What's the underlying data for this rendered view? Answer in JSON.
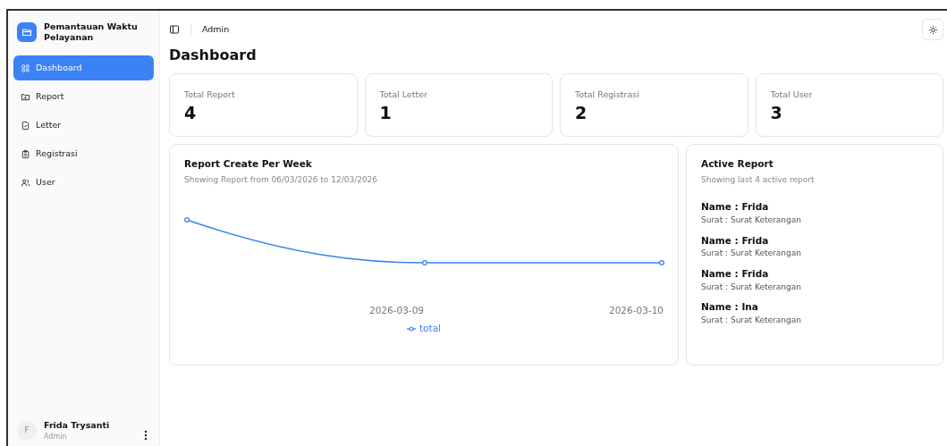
{
  "app": {
    "title": "Pemantauan Waktu Pelayanan"
  },
  "sidebar": {
    "items": [
      {
        "label": "Dashboard",
        "selected": true
      },
      {
        "label": "Report",
        "selected": false
      },
      {
        "label": "Letter",
        "selected": false
      },
      {
        "label": "Registrasi",
        "selected": false
      },
      {
        "label": "User",
        "selected": false
      }
    ]
  },
  "user": {
    "initial": "F",
    "name": "Frida Trysanti",
    "role": "Admin"
  },
  "header": {
    "breadcrumb": "Admin"
  },
  "page_title": "Dashboard",
  "stats": [
    {
      "label": "Total Report",
      "value": "4"
    },
    {
      "label": "Total Letter",
      "value": "1"
    },
    {
      "label": "Total Registrasi",
      "value": "2"
    },
    {
      "label": "Total User",
      "value": "3"
    }
  ],
  "chart_card": {
    "title": "Report Create Per Week",
    "subtitle": "Showing Report from 06/03/2026 to 12/03/2026",
    "x_labels": [
      "2026-03-09",
      "2026-03-10"
    ],
    "legend": "total"
  },
  "active_report": {
    "title": "Active Report",
    "subtitle": "Showing last 4 active report",
    "items": [
      {
        "name": "Name : Frida",
        "surat": "Surat : Surat Keterangan"
      },
      {
        "name": "Name : Frida",
        "surat": "Surat : Surat Keterangan"
      },
      {
        "name": "Name : Frida",
        "surat": "Surat : Surat Keterangan"
      },
      {
        "name": "Name : Ina",
        "surat": "Surat : Surat Keterangan"
      }
    ]
  }
}
